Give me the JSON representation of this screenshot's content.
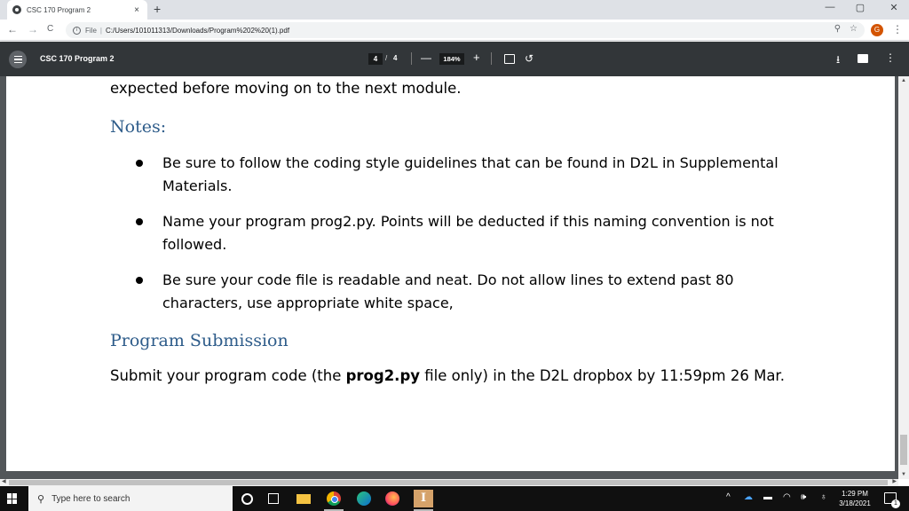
{
  "browser": {
    "tab": {
      "title": "CSC 170 Program 2",
      "close": "×",
      "favicon": "globe-icon"
    },
    "new_tab": "+",
    "window_controls": {
      "minimize": "—",
      "maximize": "▢",
      "close": "✕"
    },
    "nav": {
      "back": "←",
      "forward": "→",
      "reload": "C"
    },
    "address": {
      "info": "i",
      "scheme_label": "File",
      "separator": "|",
      "url": "C:/Users/101011313/Downloads/Program%202%20(1).pdf",
      "zoom_icon": "⚲",
      "star": "☆"
    },
    "profile_initial": "G",
    "menu": "⋮"
  },
  "pdf_toolbar": {
    "title": "CSC 170 Program 2",
    "current_page": "4",
    "page_separator": "/",
    "total_pages": "4",
    "zoom_out": "—",
    "zoom_level": "184%",
    "zoom_in": "+",
    "rotate": "↺",
    "download": "⭳",
    "more": "⋮"
  },
  "document": {
    "intro_line": "expected before moving on to the next module.",
    "notes_heading": "Notes:",
    "notes": [
      {
        "lines": [
          "Be sure to follow the coding style guidelines that can be found in D2L in Supplemental",
          "Materials."
        ]
      },
      {
        "lines": [
          "Name your program prog2.py.  Points will be deducted if this naming convention is not",
          "followed."
        ]
      },
      {
        "lines": [
          "Be sure your code file is readable and neat.  Do not allow lines to extend past 80",
          "characters, use appropriate white space,"
        ]
      }
    ],
    "submission_heading": "Program Submission",
    "submission": {
      "before": "Submit your program code (the ",
      "bold": "prog2.py",
      "after": " file only) in the D2L dropbox by 11:59pm 26 Mar."
    }
  },
  "taskbar": {
    "search_placeholder": "Type here to search",
    "search_icon": "⚲",
    "app_letter": "I",
    "tray": {
      "chevron": "^",
      "cloud": "☁",
      "battery": "▬",
      "wifi": "◠",
      "volume": "🕪",
      "extra": "♁"
    },
    "time": "1:29 PM",
    "date": "3/18/2021",
    "notification_count": "1"
  }
}
